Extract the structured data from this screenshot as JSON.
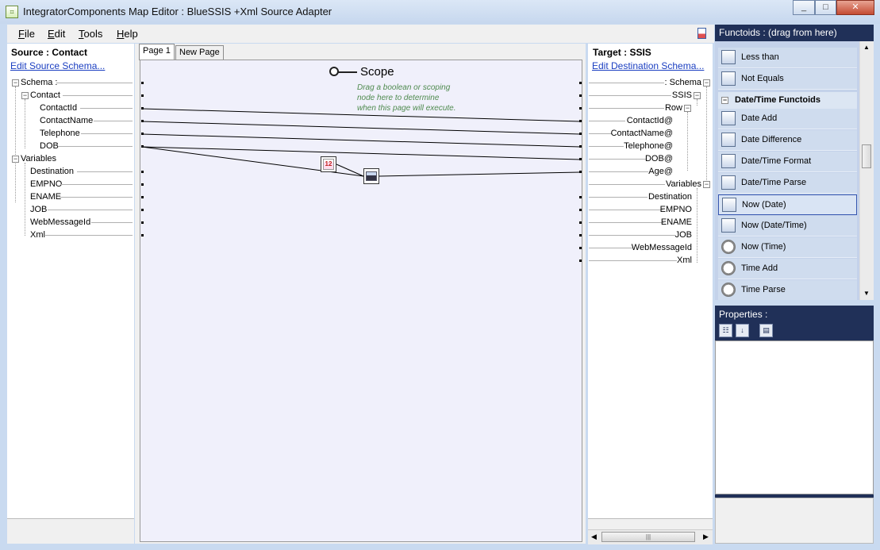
{
  "window": {
    "title": "IntegratorComponents Map Editor : BlueSSIS +Xml Source Adapter",
    "minimize": "▭",
    "maximize": "□",
    "close": "✕"
  },
  "menu": {
    "file": {
      "label": "File",
      "accel": "F",
      "rest": "ile"
    },
    "edit": {
      "label": "Edit",
      "accel": "E",
      "rest": "dit"
    },
    "tools": {
      "label": "Tools",
      "accel": "T",
      "rest": "ools"
    },
    "help": {
      "label": "Help",
      "accel": "H",
      "rest": "elp"
    }
  },
  "source": {
    "title": "Source : Contact",
    "edit_link": "Edit Source Schema...",
    "nodes": [
      "Schema :",
      "Contact",
      "ContactId",
      "ContactName",
      "Telephone",
      "DOB",
      "Variables",
      "Destination",
      "EMPNO",
      "ENAME",
      "JOB",
      "WebMessageId",
      "Xml"
    ]
  },
  "tabs": [
    "Page 1",
    "New Page"
  ],
  "canvas": {
    "scope_label": "Scope",
    "scope_help": [
      "Drag a boolean or scoping",
      "node here to determine",
      "when this page will execute."
    ],
    "functoid_now_date_badge": "12"
  },
  "target": {
    "title": "Target : SSIS",
    "edit_link": "Edit Destination Schema...",
    "nodes": [
      ": Schema",
      "SSIS",
      "Row",
      "ContactId@",
      "ContactName@",
      "Telephone@",
      "DOB@",
      "Age@",
      "Variables",
      "Destination",
      "EMPNO",
      "ENAME",
      "JOB",
      "WebMessageId",
      "Xml"
    ]
  },
  "functoids": {
    "header": "Functoids : (drag from here)",
    "items": [
      "Less than",
      "Not Equals"
    ],
    "group": "Date/Time Functoids",
    "datetime_items": [
      "Date Add",
      "Date Difference",
      "Date/Time Format",
      "Date/Time Parse",
      "Now (Date)",
      "Now (Date/Time)",
      "Now (Time)",
      "Time Add",
      "Time Parse"
    ],
    "selected": "Now (Date)"
  },
  "properties": {
    "title": "Properties :"
  },
  "hscroll_grip": "|||",
  "colors": {
    "header_bg": "#203058",
    "panel_bg": "#c4d2ea",
    "link": "#1a3ec1",
    "canvas_bg": "#f0f0fb"
  }
}
